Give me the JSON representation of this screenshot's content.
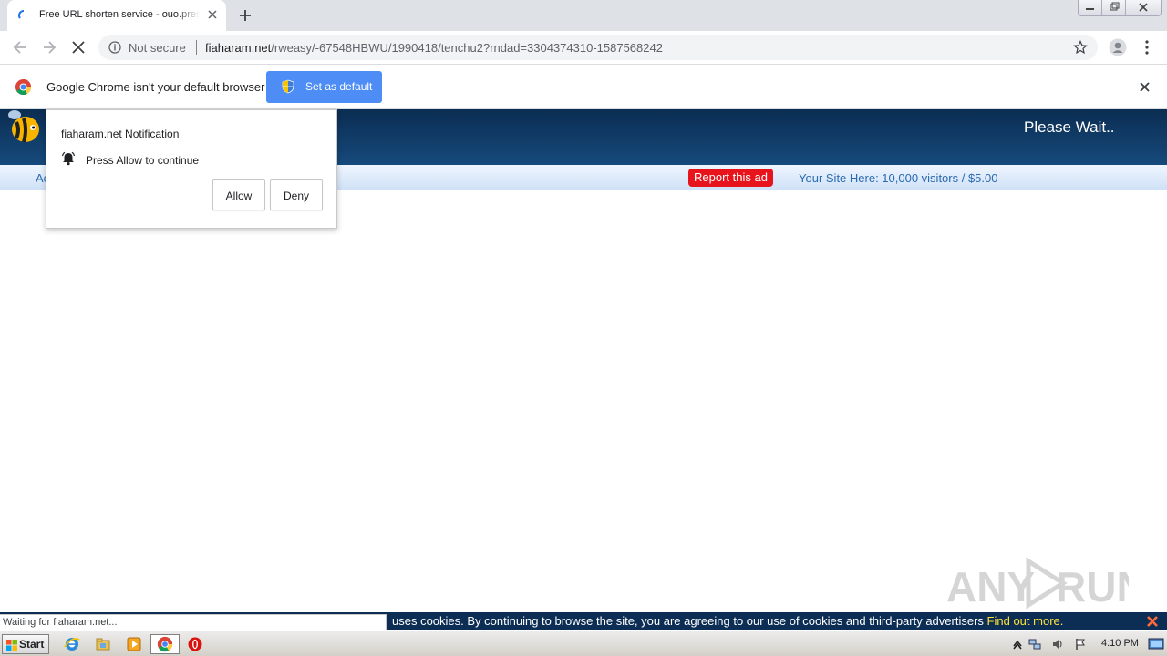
{
  "browser": {
    "tab": {
      "title": "Free URL shorten service - ouo.press"
    },
    "omnibox": {
      "security_label": "Not secure",
      "url_host": "fiaharam.net",
      "url_path": "/rweasy/-67548HBWU/1990418/tenchu2?rndad=3304374310-1587568242"
    },
    "infobar": {
      "message": "Google Chrome isn't your default browser",
      "button_label": "Set as default",
      "button_color": "#4d8df5"
    },
    "status_text": "Waiting for fiaharam.net..."
  },
  "notification": {
    "title": "fiaharam.net Notification",
    "message": "Press Allow to continue",
    "allow_label": "Allow",
    "deny_label": "Deny"
  },
  "site": {
    "header_text": "Please Wait..",
    "nav_partial": "Ac",
    "report_ad_label": "Report this ad",
    "promo_text": "Your Site Here: 10,000 visitors / $5.00",
    "header_color": "#0b2d52",
    "report_color": "#e8141c"
  },
  "cookie_bar": {
    "text": "uses cookies. By continuing to browse the site, you are agreeing to our use of cookies and third-party advertisers",
    "link_text": "Find out more.",
    "link_color": "#ffe23a"
  },
  "watermark": {
    "text": "ANY RUN"
  },
  "taskbar": {
    "start_label": "Start",
    "clock": "4:10 PM",
    "icons": [
      "ie-icon",
      "explorer-icon",
      "media-player-icon",
      "chrome-icon",
      "opera-icon"
    ]
  }
}
